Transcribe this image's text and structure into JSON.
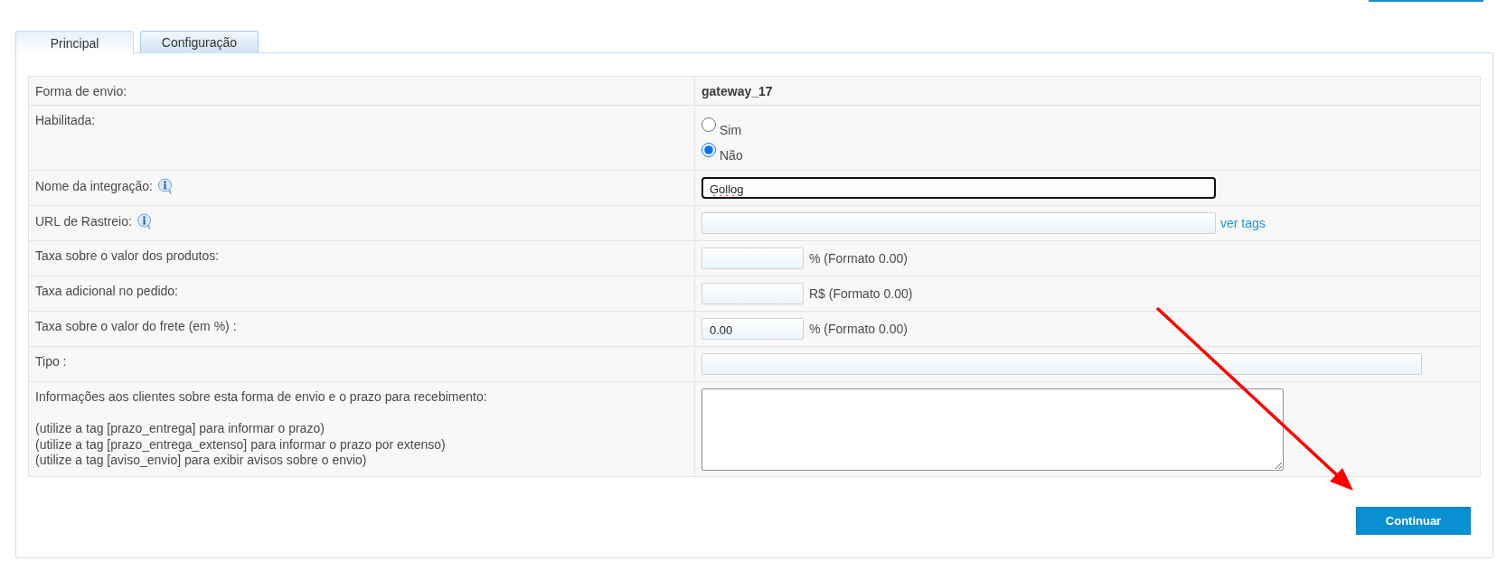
{
  "tabs": [
    {
      "label": "Principal",
      "selected": true
    },
    {
      "label": "Configuração",
      "selected": false
    }
  ],
  "form": {
    "rows": [
      {
        "kind": "value",
        "label": "Forma de envio:",
        "info": false,
        "value": "gateway_17"
      },
      {
        "kind": "radio",
        "label": "Habilitada:",
        "info": false,
        "options": [
          {
            "label": "Sim",
            "selected": false
          },
          {
            "label": "Não",
            "selected": true
          }
        ]
      },
      {
        "kind": "text",
        "label": "Nome da integração:",
        "info": true,
        "value": "Gollog",
        "focused": true,
        "spell_error": true
      },
      {
        "kind": "text",
        "label": "URL de Rastreio:",
        "info": true,
        "focused": false,
        "link": "ver tags"
      },
      {
        "kind": "number",
        "label": "Taxa sobre o valor dos produtos:",
        "info": false,
        "focused": false,
        "suffix": "% (Formato 0.00)"
      },
      {
        "kind": "number",
        "label": "Taxa adicional no pedido:",
        "info": false,
        "focused": false,
        "suffix": "R$ (Formato 0.00)"
      },
      {
        "kind": "number",
        "label": "Taxa sobre o valor do frete (em %) :",
        "info": false,
        "focused": false,
        "value": "0.00",
        "suffix": "% (Formato 0.00)"
      },
      {
        "kind": "long_text",
        "label": "Tipo :",
        "info": false,
        "focused": false
      },
      {
        "kind": "textarea",
        "label": "Informações aos clientes sobre esta forma de envio e o prazo para recebimento:",
        "info": false,
        "focused": false,
        "hints": [
          "(utilize a tag [prazo_entrega] para informar o prazo)",
          "(utilize a tag [prazo_entrega_extenso] para informar o prazo por extenso)",
          "(utilize a tag [aviso_envio] para exibir avisos sobre o envio)"
        ]
      }
    ]
  },
  "buttons": [
    {
      "label": "Continuar"
    }
  ]
}
